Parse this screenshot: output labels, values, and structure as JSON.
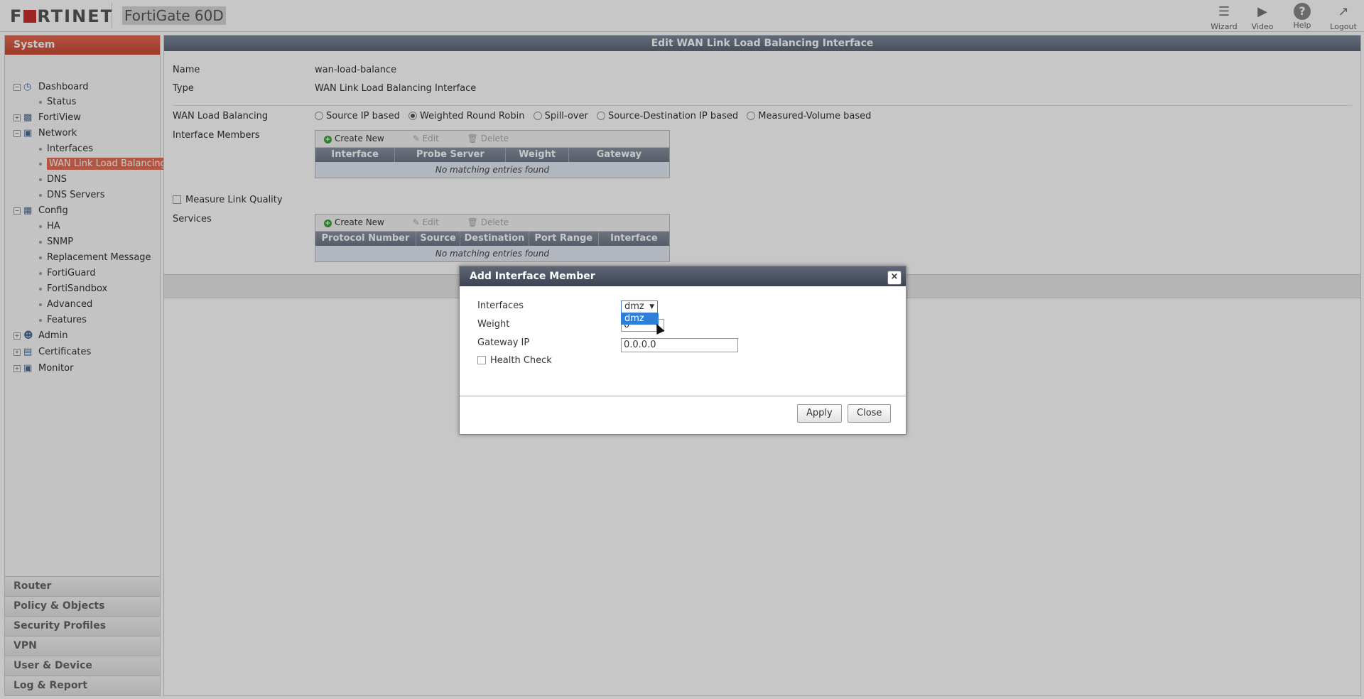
{
  "header": {
    "brand": "FORTINET",
    "device": "FortiGate 60D",
    "buttons": [
      {
        "label": "Wizard",
        "icon": "wizard-icon"
      },
      {
        "label": "Video",
        "icon": "video-icon"
      },
      {
        "label": "Help",
        "icon": "help-icon"
      },
      {
        "label": "Logout",
        "icon": "logout-icon"
      }
    ]
  },
  "sidebar": {
    "section": "System",
    "tree": [
      {
        "label": "Dashboard",
        "type": "folder",
        "icon": "dashboard-icon"
      },
      {
        "label": "Status",
        "type": "leaf"
      },
      {
        "label": "FortiView",
        "type": "folder",
        "icon": "fortiview-icon"
      },
      {
        "label": "Network",
        "type": "folder",
        "icon": "network-icon"
      },
      {
        "label": "Interfaces",
        "type": "leaf"
      },
      {
        "label": "WAN Link Load Balancing",
        "type": "leaf",
        "selected": true
      },
      {
        "label": "DNS",
        "type": "leaf"
      },
      {
        "label": "DNS Servers",
        "type": "leaf"
      },
      {
        "label": "Config",
        "type": "folder",
        "icon": "config-icon"
      },
      {
        "label": "HA",
        "type": "leaf"
      },
      {
        "label": "SNMP",
        "type": "leaf"
      },
      {
        "label": "Replacement Message",
        "type": "leaf"
      },
      {
        "label": "FortiGuard",
        "type": "leaf"
      },
      {
        "label": "FortiSandbox",
        "type": "leaf"
      },
      {
        "label": "Advanced",
        "type": "leaf"
      },
      {
        "label": "Features",
        "type": "leaf"
      },
      {
        "label": "Admin",
        "type": "folder",
        "icon": "admin-icon"
      },
      {
        "label": "Certificates",
        "type": "folder",
        "icon": "certificates-icon"
      },
      {
        "label": "Monitor",
        "type": "folder",
        "icon": "monitor-icon"
      }
    ],
    "sections": [
      "Router",
      "Policy & Objects",
      "Security Profiles",
      "VPN",
      "User & Device",
      "Log & Report"
    ]
  },
  "main": {
    "title": "Edit WAN Link Load Balancing Interface",
    "name_label": "Name",
    "name_value": "wan-load-balance",
    "type_label": "Type",
    "type_value": "WAN Link Load Balancing Interface",
    "wlb_label": "WAN Load Balancing",
    "wlb_options": [
      "Source IP based",
      "Weighted Round Robin",
      "Spill-over",
      "Source-Destination IP based",
      "Measured-Volume based"
    ],
    "wlb_selected": "Weighted Round Robin",
    "members_label": "Interface Members",
    "members_toolbar": {
      "create": "Create New",
      "edit": "Edit",
      "delete": "Delete"
    },
    "members_columns": [
      "Interface",
      "Probe Server",
      "Weight",
      "Gateway"
    ],
    "members_empty": "No matching entries found",
    "measure_label": "Measure Link Quality",
    "services_label": "Services",
    "services_toolbar": {
      "create": "Create New",
      "edit": "Edit",
      "delete": "Delete"
    },
    "services_columns": [
      "Protocol Number",
      "Source",
      "Destination",
      "Port Range",
      "Interface"
    ],
    "services_empty": "No matching entries found"
  },
  "dialog": {
    "title": "Add Interface Member",
    "interfaces_label": "Interfaces",
    "interfaces_value": "dmz",
    "interfaces_option": "dmz",
    "weight_label": "Weight",
    "weight_value": "0",
    "gateway_label": "Gateway IP",
    "gateway_value": "0.0.0.0",
    "health_label": "Health Check",
    "apply": "Apply",
    "close": "Close"
  }
}
